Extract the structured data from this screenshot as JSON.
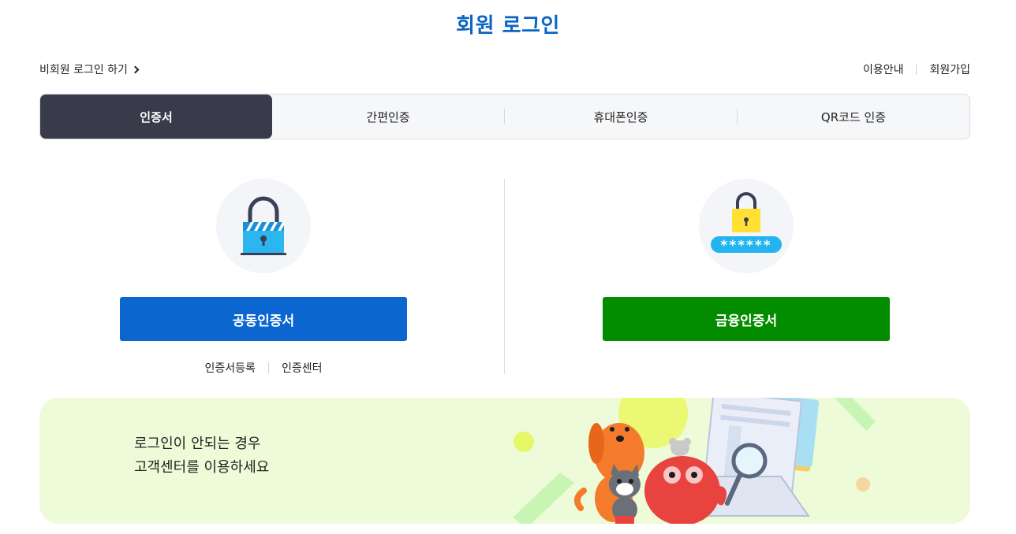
{
  "header": {
    "title": "회원 로그인"
  },
  "guest_login": {
    "label": "비회원 로그인 하기"
  },
  "top_links": {
    "guide": "이용안내",
    "signup": "회원가입"
  },
  "tabs": [
    {
      "label": "인증서",
      "active": true
    },
    {
      "label": "간편인증",
      "active": false
    },
    {
      "label": "휴대폰인증",
      "active": false
    },
    {
      "label": "QR코드 인증",
      "active": false
    }
  ],
  "left_panel": {
    "icon": "blue-lock-icon",
    "button_label": "공동인증서",
    "links": {
      "register": "인증서등록",
      "center": "인증센터"
    }
  },
  "right_panel": {
    "icon": "yellow-lock-password-icon",
    "password_mask": "******",
    "button_label": "금융인증서"
  },
  "banner": {
    "line1": "로그인이 안되는 경우",
    "line2": "고객센터를 이용하세요",
    "illustration": "mascot-characters-with-magnifier"
  },
  "colors": {
    "title": "#0b66c3",
    "active_tab": "#393b4b",
    "blue_button": "#0b66d0",
    "green_button": "#038c00",
    "banner_bg": "#edfbd8"
  }
}
